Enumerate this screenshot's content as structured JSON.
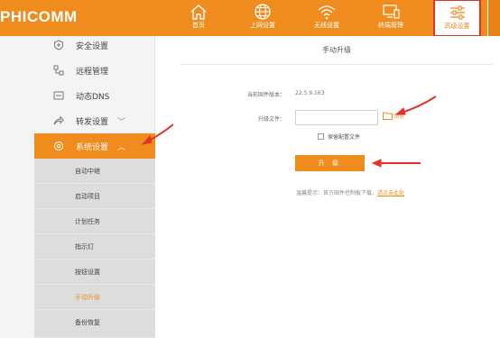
{
  "brand": {
    "logo": "PHICOMM",
    "accent": "#f08c1e",
    "highlight": "#d9362b"
  },
  "topnav": {
    "items": [
      {
        "label": "首页",
        "icon": "home-icon"
      },
      {
        "label": "上网设置",
        "icon": "globe-icon"
      },
      {
        "label": "无线设置",
        "icon": "wifi-icon"
      },
      {
        "label": "终端管理",
        "icon": "device-icon"
      },
      {
        "label": "高级设置",
        "icon": "sliders-icon",
        "active": true
      }
    ]
  },
  "sidebar": {
    "items": [
      {
        "label": "安全设置",
        "icon": "shield-icon"
      },
      {
        "label": "远程管理",
        "icon": "remote-icon"
      },
      {
        "label": "动态DNS",
        "icon": "dns-icon"
      },
      {
        "label": "转发设置",
        "icon": "forward-icon",
        "chevron": "﹀"
      },
      {
        "label": "系统设置",
        "icon": "system-icon",
        "chevron": "︿",
        "active": true
      }
    ],
    "subitems": [
      {
        "label": "自动中继"
      },
      {
        "label": "启动项目"
      },
      {
        "label": "计划任务"
      },
      {
        "label": "指示灯"
      },
      {
        "label": "按钮设置"
      },
      {
        "label": "手动升级",
        "current": true
      },
      {
        "label": "备份恢复"
      }
    ]
  },
  "main": {
    "title": "手动升级",
    "current_version_label": "当前固件版本：",
    "current_version_value": "22.5.9.163",
    "file_label": "升级文件：",
    "file_value": "",
    "browse_label": "浏览",
    "keep_config_label": "保留配置文件",
    "keep_config_checked": false,
    "upgrade_button": "升 级",
    "tip_text": "温馨提示：官方固件控制板下载，",
    "tip_link": "请点击此处"
  }
}
